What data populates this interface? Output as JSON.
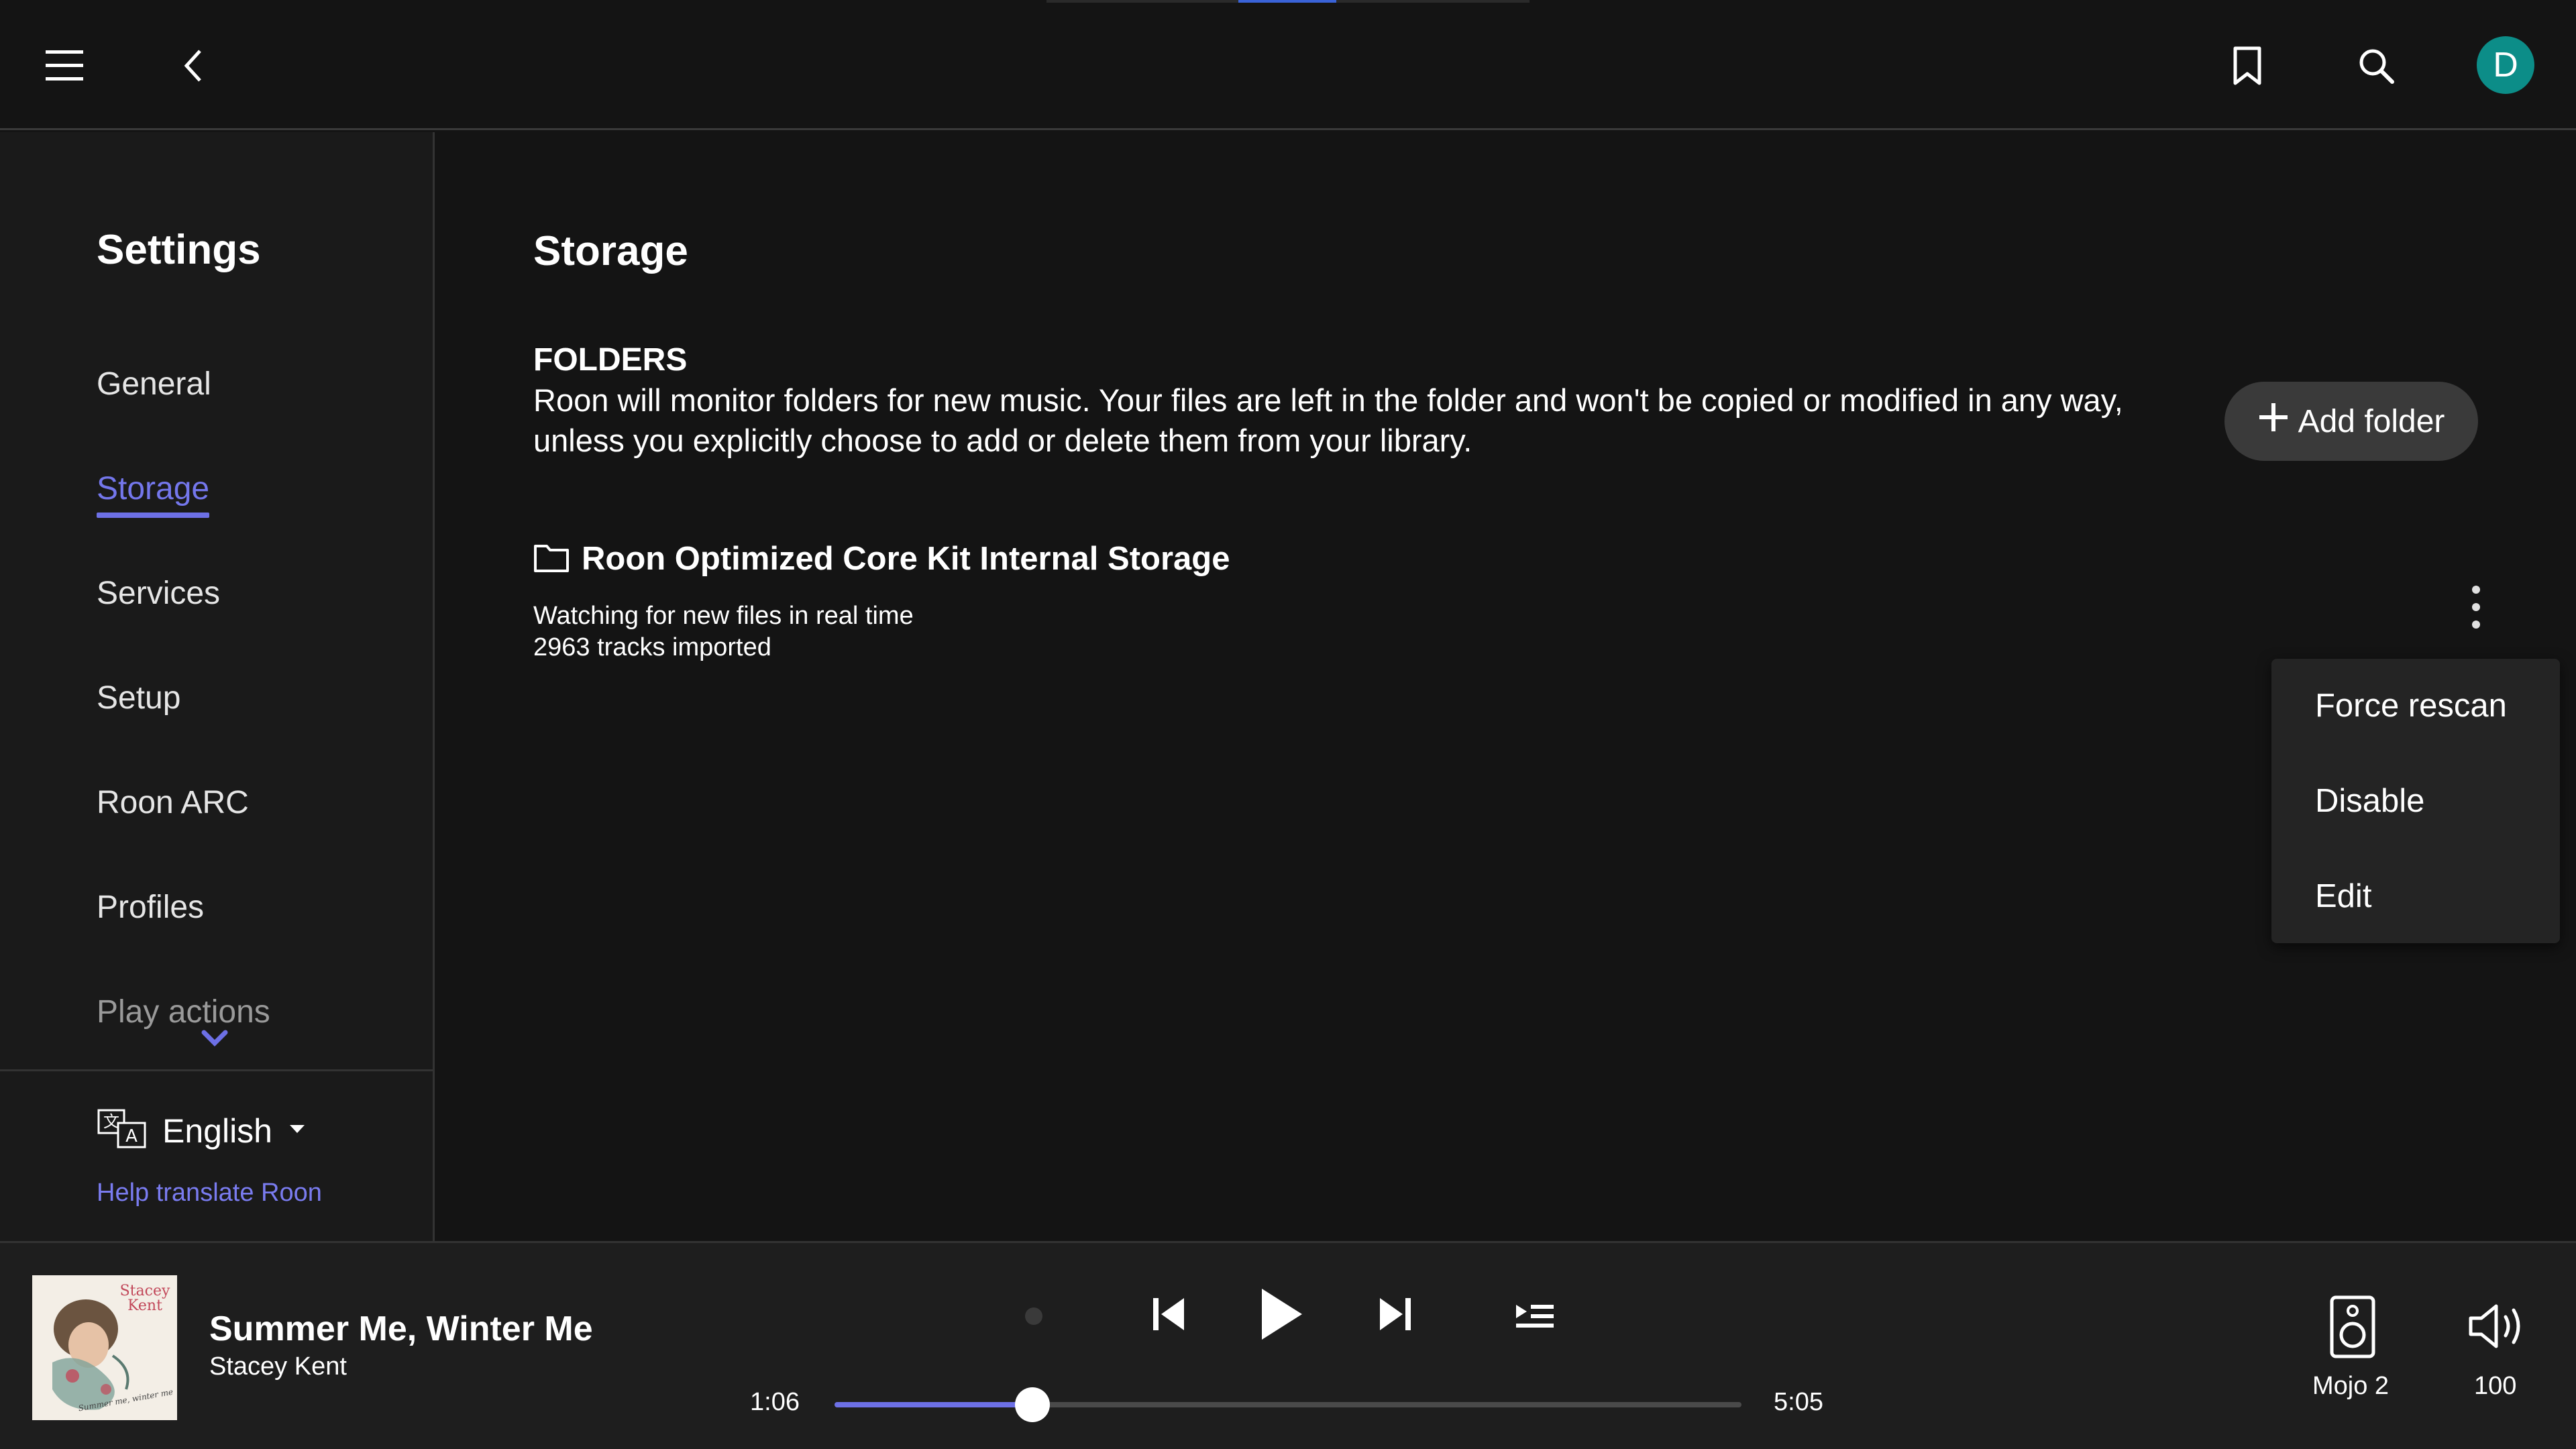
{
  "topbar": {
    "menu_icon": "hamburger-menu-icon",
    "back_icon": "chevron-left-icon",
    "bookmark_icon": "bookmark-icon",
    "search_icon": "search-icon",
    "avatar_letter": "D",
    "avatar_color": "#0c8d88"
  },
  "sidebar": {
    "title": "Settings",
    "items": [
      {
        "label": "General"
      },
      {
        "label": "Storage"
      },
      {
        "label": "Services"
      },
      {
        "label": "Setup"
      },
      {
        "label": "Roon ARC"
      },
      {
        "label": "Profiles"
      },
      {
        "label": "Play actions"
      }
    ],
    "active_item": "Storage",
    "language": "English",
    "help_link": "Help translate Roon"
  },
  "main": {
    "title": "Storage",
    "section_title": "FOLDERS",
    "section_desc": "Roon will monitor folders for new music. Your files are left in the folder and won't be copied or modified in any way, unless you explicitly choose to add or delete them from your library.",
    "add_folder_label": "Add folder",
    "folder": {
      "name": "Roon Optimized Core Kit Internal Storage",
      "status_line1": "Watching for new files in real time",
      "status_line2": "2963 tracks imported"
    },
    "menu": {
      "items": [
        "Force rescan",
        "Disable",
        "Edit"
      ]
    }
  },
  "player": {
    "track_title": "Summer Me, Winter Me",
    "artist": "Stacey Kent",
    "album_text": [
      "Stacey",
      "Kent",
      "Summer me, winter me"
    ],
    "elapsed": "1:06",
    "duration": "5:05",
    "progress_fraction": 0.218,
    "zone_name": "Mojo 2",
    "volume": "100",
    "accent_color": "#6d70e6"
  }
}
